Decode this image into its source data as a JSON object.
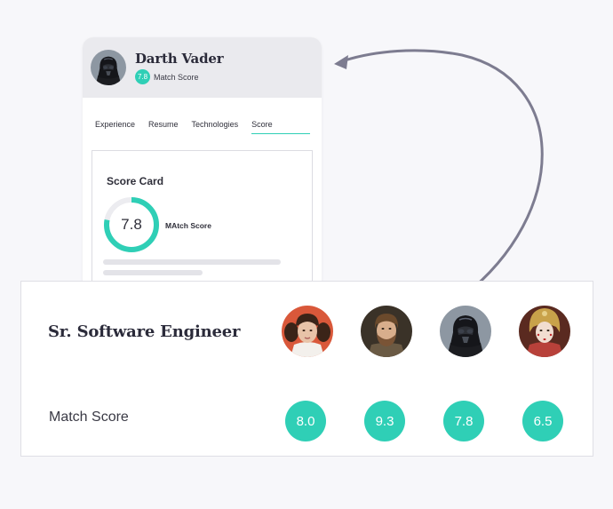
{
  "profile": {
    "name": "Darth Vader",
    "match_score": "7.8",
    "match_score_label": "Match Score",
    "avatar_icon": "darth-vader-avatar"
  },
  "tabs": [
    {
      "label": "Experience",
      "active": false
    },
    {
      "label": "Resume",
      "active": false
    },
    {
      "label": "Technologies",
      "active": false
    },
    {
      "label": "Score",
      "active": true
    }
  ],
  "score_card": {
    "title": "Score Card",
    "value": "7.8",
    "label": "MAtch Score",
    "fraction": 0.78
  },
  "job": {
    "title": "Sr. Software Engineer",
    "match_label": "Match Score",
    "candidates": [
      {
        "avatar_icon": "princess-leia-avatar",
        "score": "8.0"
      },
      {
        "avatar_icon": "obi-wan-kenobi-avatar",
        "score": "9.3"
      },
      {
        "avatar_icon": "darth-vader-avatar",
        "score": "7.8"
      },
      {
        "avatar_icon": "padme-amidala-avatar",
        "score": "6.5"
      }
    ]
  },
  "colors": {
    "accent": "#2fcfb6",
    "arrow": "#7d7c90",
    "header_bg": "#eaeaee",
    "background": "#f7f7fa"
  }
}
